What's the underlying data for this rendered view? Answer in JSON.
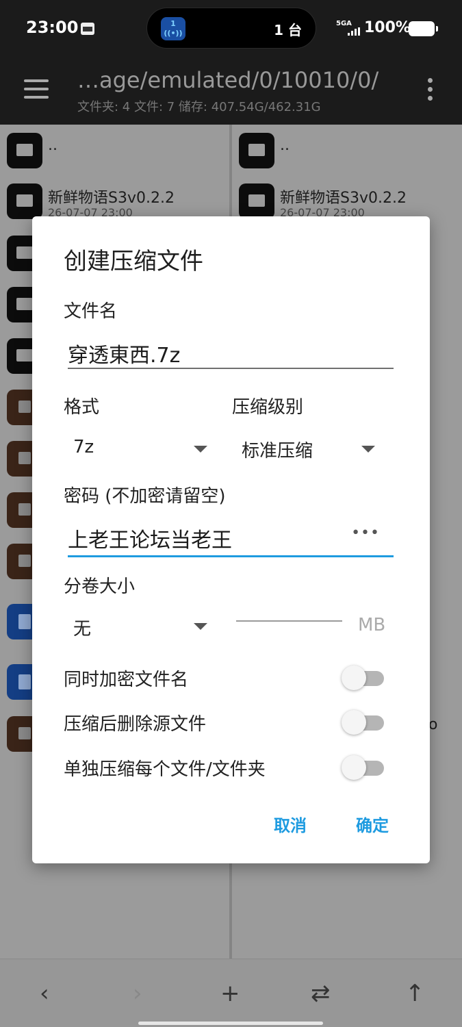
{
  "status_bar": {
    "time": "23:00",
    "island_app_num": "1",
    "island_count": "1 台",
    "network": "5GA",
    "battery": "100%"
  },
  "app_bar": {
    "path": "…age/emulated/0/10010/0/",
    "info": "文件夹: 4  文件: 7  储存: 407.54G/462.31G"
  },
  "left_pane": {
    "parent": "..",
    "item1_name": "新鲜物语S3v0.2.2",
    "item1_date": "26-07-07 23:00"
  },
  "right_pane": {
    "parent": "..",
    "item1_name": "新鲜物语S3v0.2.2",
    "item1_date": "26-07-07 23:00",
    "stray_text": "o"
  },
  "dialog": {
    "title": "创建压缩文件",
    "filename_label": "文件名",
    "filename_value": "穿透東西.7z",
    "format_label": "格式",
    "format_value": "7z",
    "level_label": "压缩级别",
    "level_value": "标准压缩",
    "password_label": "密码 (不加密请留空)",
    "password_value": "上老王论坛当老王",
    "password_dots": "•••",
    "volume_label": "分卷大小",
    "volume_value": "无",
    "volume_unit": "MB",
    "opt_encrypt_names": "同时加密文件名",
    "opt_delete_source": "压缩后删除源文件",
    "opt_separate": "单独压缩每个文件/文件夹",
    "cancel": "取消",
    "ok": "确定"
  },
  "bottom_bar": {
    "back": "‹",
    "forward": "›",
    "add": "+",
    "swap": "⇄",
    "up": "↑"
  },
  "colors": {
    "accent": "#1e9be0",
    "bar_bg": "#1b1b1b",
    "dim_bg": "#9b9b9b"
  }
}
